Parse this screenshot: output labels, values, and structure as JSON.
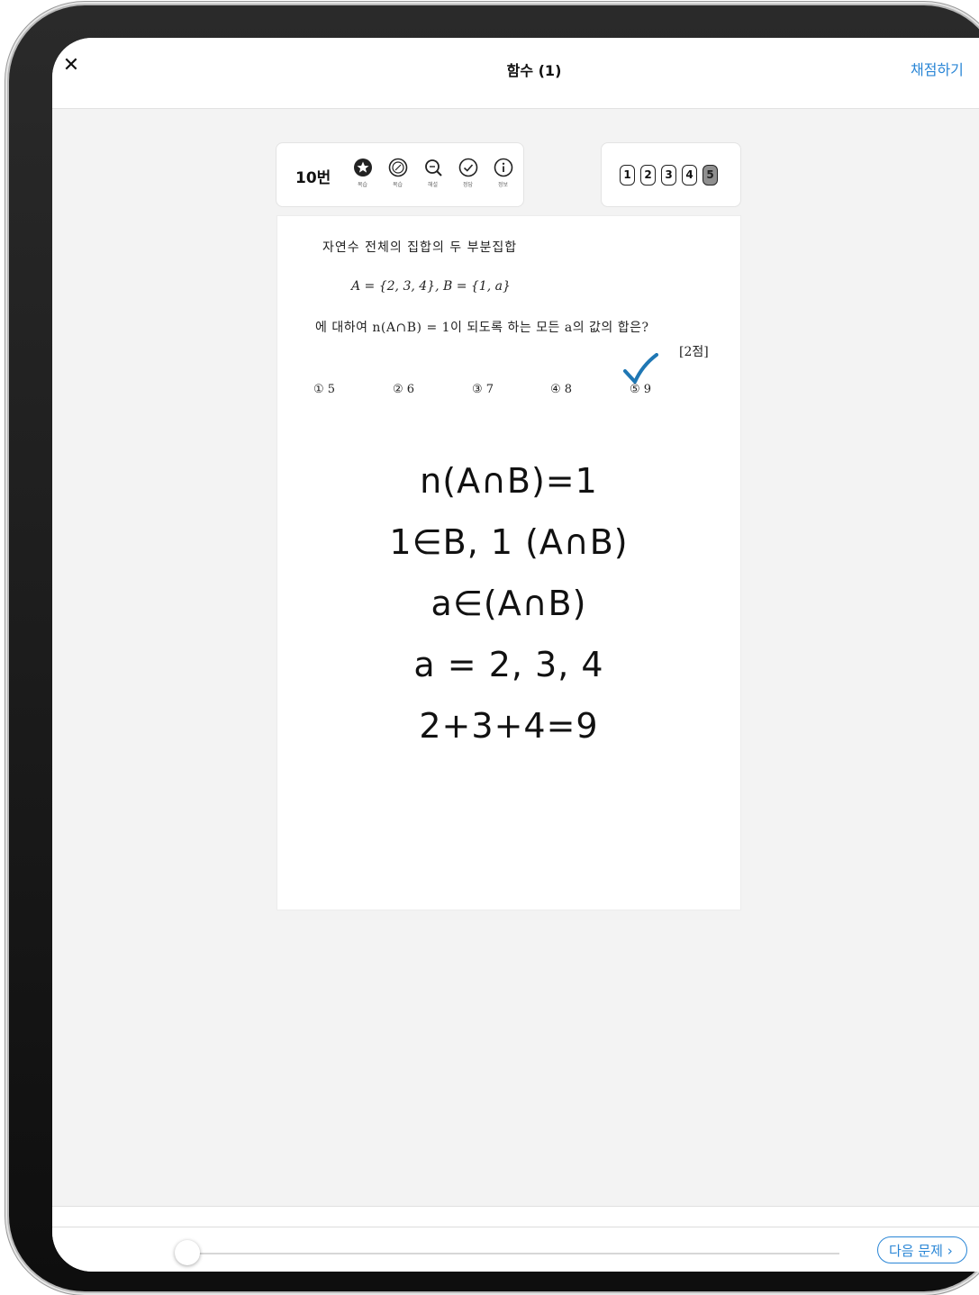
{
  "topbar": {
    "close_icon": "close-icon",
    "title": "함수 (1)",
    "grade_label": "채점하기",
    "accent": "#2a86d6"
  },
  "toolbar": {
    "question_number": "10번",
    "tools": [
      {
        "icon": "star-icon",
        "label": "복습"
      },
      {
        "icon": "percent-icon",
        "label": "복습"
      },
      {
        "icon": "zoom-icon",
        "label": "해설"
      },
      {
        "icon": "check-circle-icon",
        "label": "정답"
      },
      {
        "icon": "info-icon",
        "label": "정보"
      }
    ]
  },
  "answers": {
    "choices": [
      "1",
      "2",
      "3",
      "4",
      "5"
    ],
    "selected": "5"
  },
  "problem": {
    "line1": "자연수 전체의 집합의 두 부분집합",
    "line2": "A = {2, 3, 4},  B = {1, a}",
    "line3": "에 대하여 n(A∩B) = 1이 되도록 하는 모든 a의 값의 합은?",
    "points": "[2점]",
    "options": [
      "① 5",
      "② 6",
      "③ 7",
      "④ 8",
      "⑤ 9"
    ]
  },
  "handwriting": {
    "lines": [
      "n(A∩B)=1",
      "1∈B, 1 (A∩B)",
      "a∈(A∩B)",
      "a = 2, 3, 4",
      "2+3+4=9"
    ],
    "check_color": "#1f77b4"
  },
  "bottom": {
    "slider_value": 0,
    "next_label": "다음 문제",
    "next_icon": "chevron-right-icon"
  }
}
